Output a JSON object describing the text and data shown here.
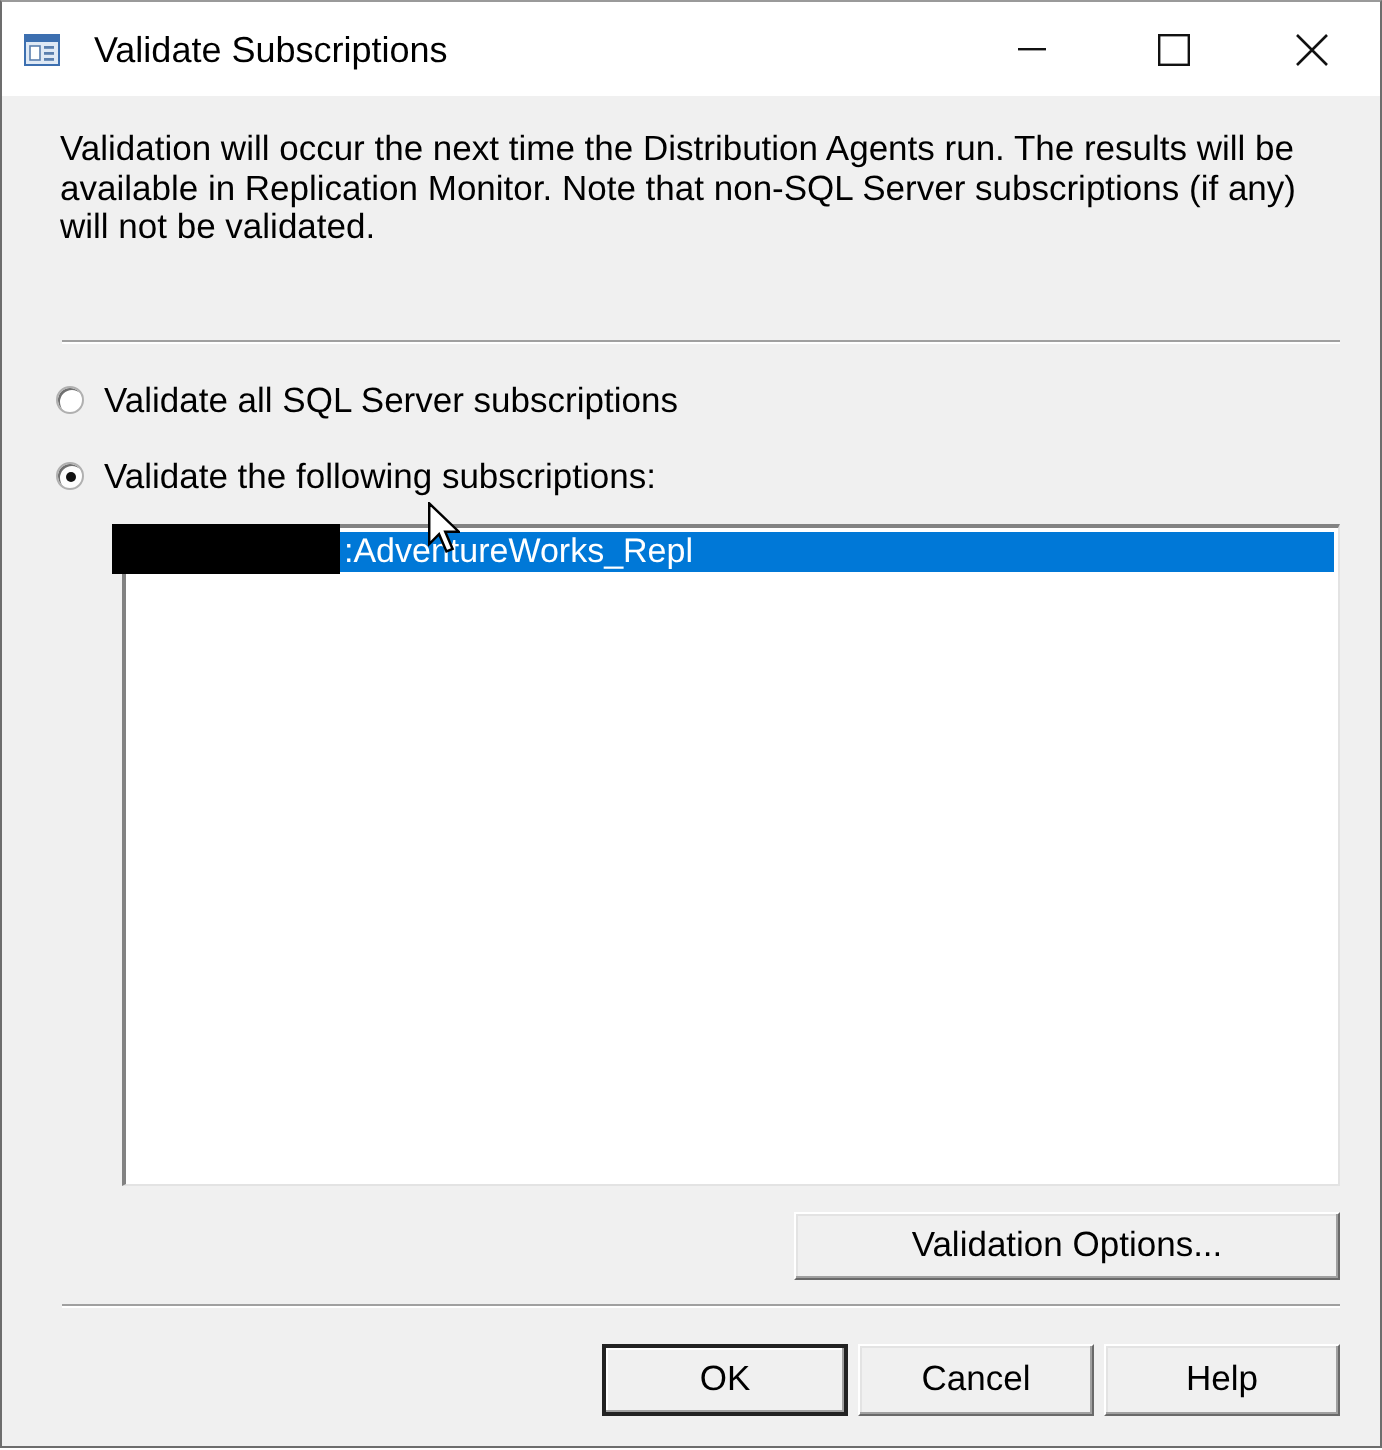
{
  "window": {
    "title": "Validate Subscriptions"
  },
  "description": "Validation will occur the next time the Distribution Agents run. The results will be available in Replication Monitor. Note that non-SQL Server subscriptions (if any) will not be validated.",
  "options": [
    {
      "label": "Validate all SQL Server subscriptions",
      "selected": false
    },
    {
      "label": "Validate the following subscriptions:",
      "selected": true
    }
  ],
  "subscriptions": [
    {
      "label": ":AdventureWorks_Repl",
      "selected": true,
      "redacted": true
    }
  ],
  "options_button": "Validation Options...",
  "buttons": [
    {
      "label": "OK",
      "default": true
    },
    {
      "label": "Cancel",
      "default": false
    },
    {
      "label": "Help",
      "default": false
    }
  ]
}
